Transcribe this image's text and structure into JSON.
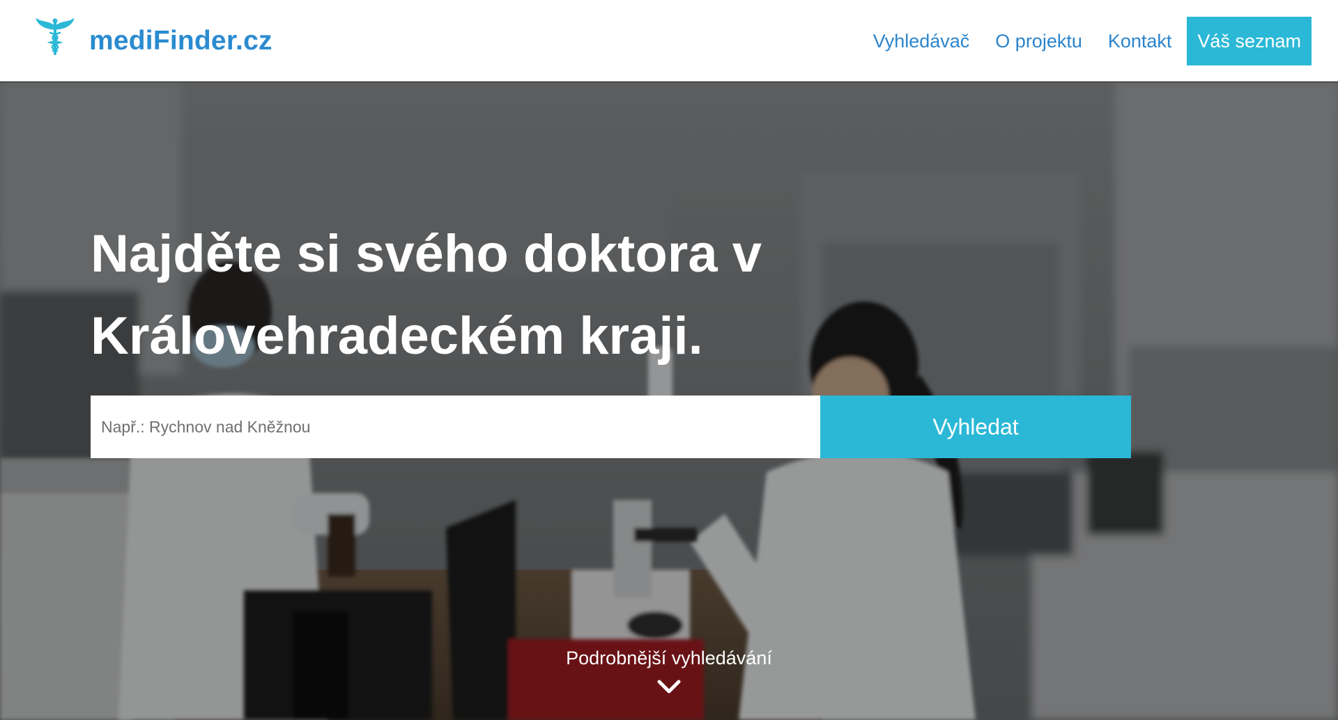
{
  "brand": {
    "name": "mediFinder.cz",
    "icon": "caduceus-icon",
    "color": "#2b8bd0"
  },
  "nav": {
    "items": [
      "Vyhledávač",
      "O projektu",
      "Kontakt"
    ],
    "cta": "Váš seznam",
    "link_color": "#2b84cc",
    "cta_color": "#2bb8d6"
  },
  "hero": {
    "title": "Najděte si svého doktora v Královehradeckém kraji.",
    "background": "laboratory-photo"
  },
  "search": {
    "placeholder": "Např.: Rychnov nad Kněžnou",
    "value": "",
    "button_label": "Vyhledat"
  },
  "advanced": {
    "label": "Podrobnější vyhledávání",
    "icon": "chevron-down-icon"
  }
}
